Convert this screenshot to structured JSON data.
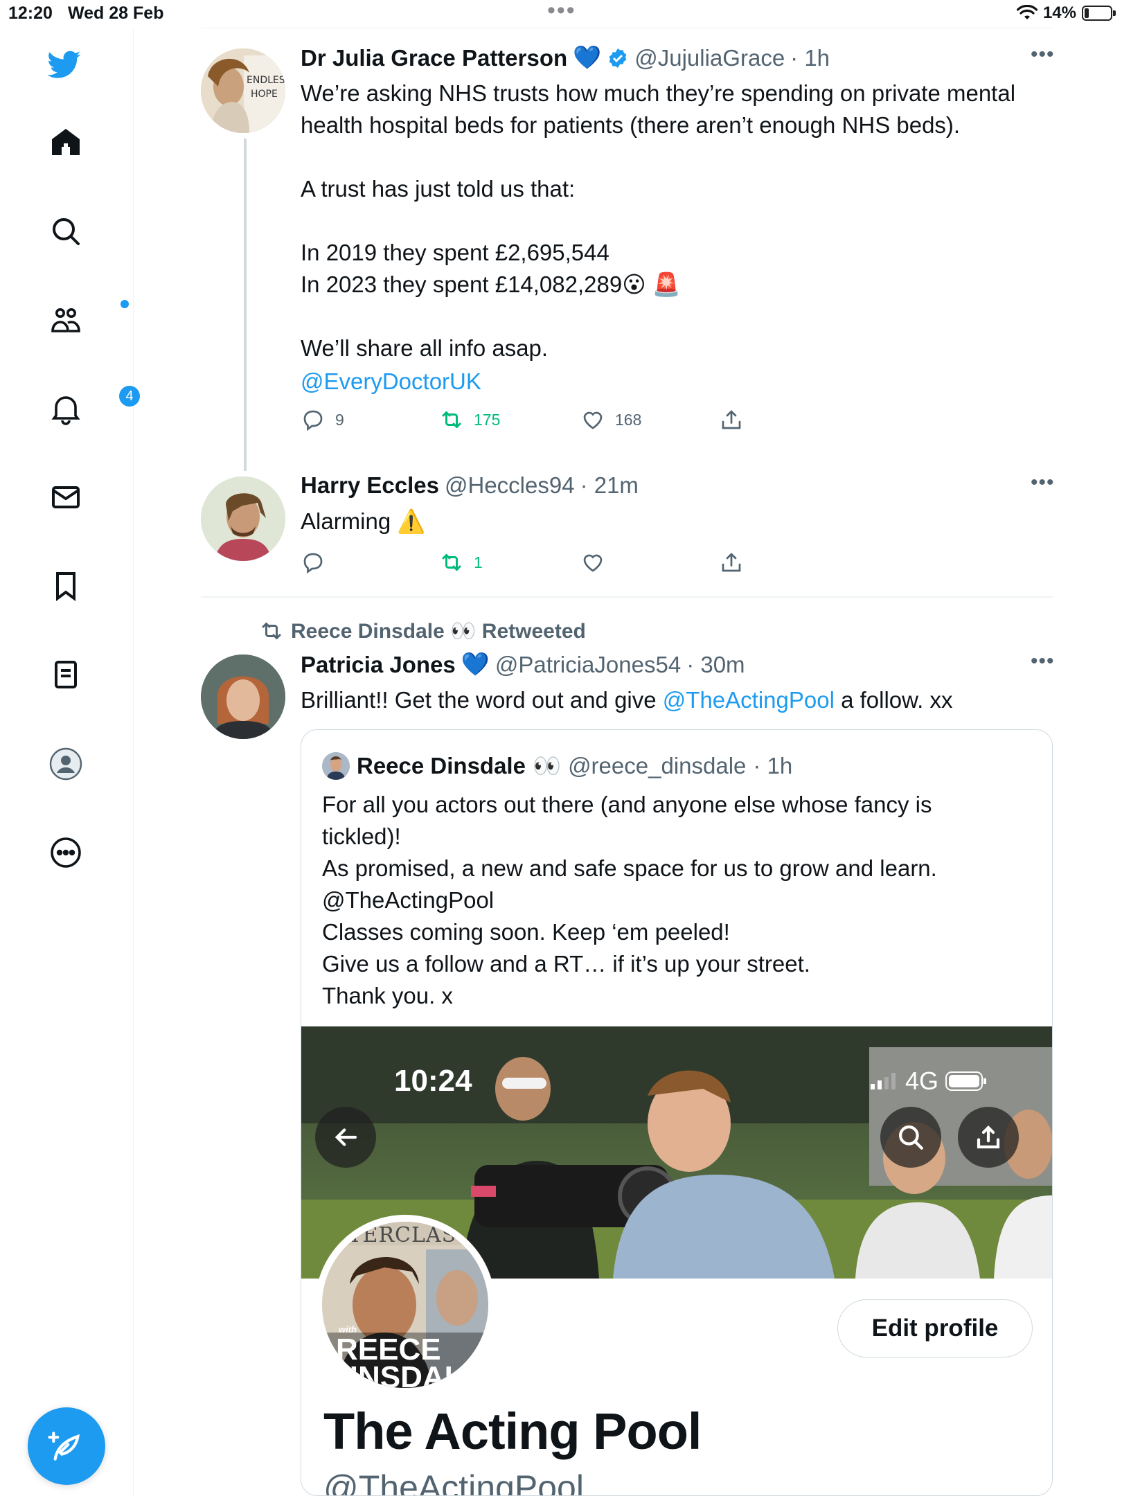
{
  "status_bar": {
    "time": "12:20",
    "date": "Wed 28 Feb",
    "battery": "14%",
    "dots": "•••"
  },
  "sidebar": {
    "notifications_badge": "4",
    "icons": [
      "twitter-logo-icon",
      "home-icon",
      "search-icon",
      "communities-icon",
      "notifications-icon",
      "messages-icon",
      "bookmarks-icon",
      "lists-icon",
      "profile-icon",
      "more-icon"
    ]
  },
  "tweets": [
    {
      "name": "Dr Julia Grace Patterson",
      "emoji": "💙",
      "handle": "@JujuliaGrace",
      "time": "· 1h",
      "text": "We’re asking NHS trusts how much they’re spending on private mental\nhealth hospital beds for patients (there aren’t enough NHS beds).\n\nA trust has just told us that:\n\nIn 2019 they spent £2,695,544\nIn 2023 they spent £14,082,289😮 🚨\n\nWe’ll share all info asap.",
      "mention": "@EveryDoctorUK",
      "replies": "9",
      "retweets": "175",
      "likes": "168"
    },
    {
      "name": "Harry Eccles",
      "handle": "@Heccles94",
      "time": "· 21m",
      "text": "Alarming ⚠️",
      "replies": "",
      "retweets": "1",
      "likes": ""
    },
    {
      "retweeted_by": "Reece Dinsdale 👀 Retweeted",
      "name": "Patricia Jones",
      "emoji": "💙",
      "handle": "@PatriciaJones54",
      "time": "· 30m",
      "text_before": "Brilliant!! Get the word out and give ",
      "mention": "@TheActingPool",
      "text_after": " a follow. xx"
    }
  ],
  "quote": {
    "name": "Reece Dinsdale",
    "emoji": "👀",
    "handle": "@reece_dinsdale",
    "time": "· 1h",
    "text": "For all you actors out there (and anyone else whose fancy is\ntickled)!\nAs promised, a new and safe space for us to grow and learn.\n@TheActingPool\nClasses coming soon. Keep ‘em peeled!\nGive us a follow and a RT… if it’s up your street.\nThank you. x",
    "image": {
      "time": "10:24",
      "network": "4G",
      "avatar_text_top": "STERCLAS",
      "avatar_text_with": "with",
      "avatar_text_name": "REECE",
      "avatar_text_name2": "DINSDAL",
      "edit_button": "Edit profile",
      "account_name": "The Acting Pool",
      "account_handle": "@TheActingPool"
    }
  },
  "colors": {
    "accent": "#1d9bf0",
    "retweet_green": "#00ba7c",
    "secondary_text": "#536471"
  }
}
